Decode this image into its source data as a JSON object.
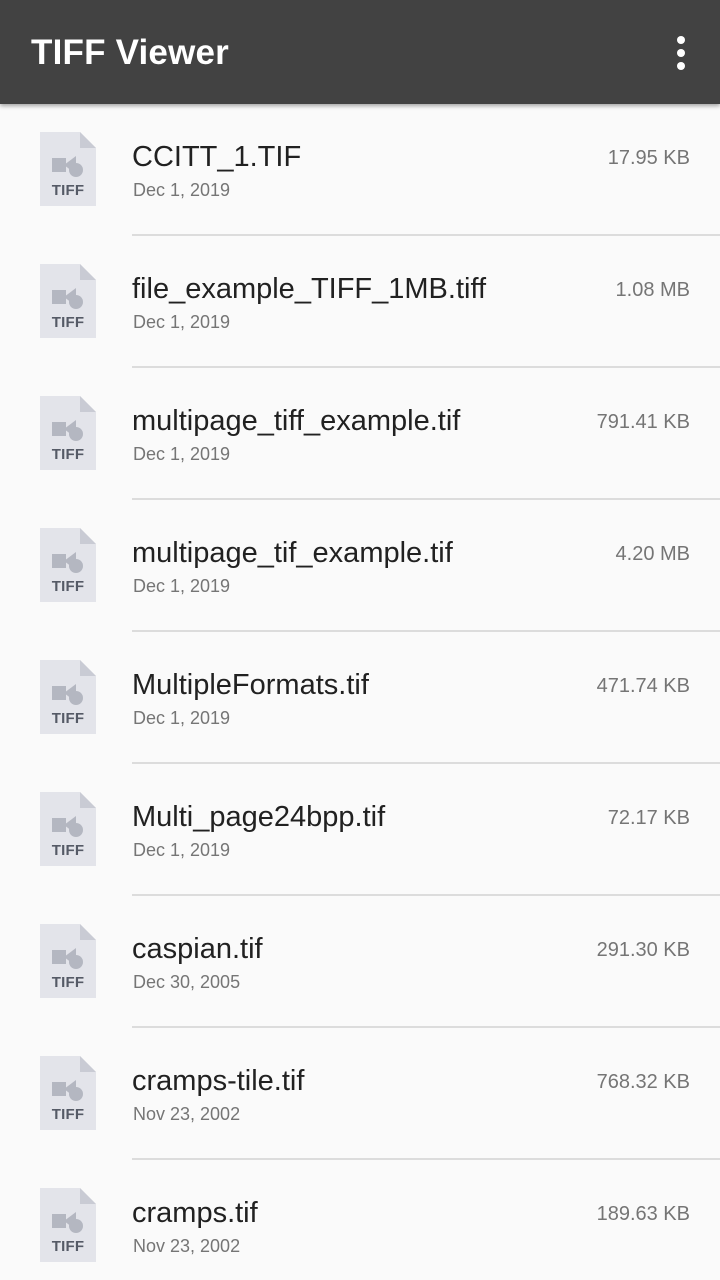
{
  "app": {
    "title": "TIFF Viewer",
    "menu_icon": "more-vert-icon",
    "toolbar_color": "#424242"
  },
  "file_icon": {
    "name": "tiff-file-icon",
    "label": "TIFF"
  },
  "files": [
    {
      "name": "CCITT_1.TIF",
      "date": "Dec 1, 2019",
      "size": "17.95 KB"
    },
    {
      "name": "file_example_TIFF_1MB.tiff",
      "date": "Dec 1, 2019",
      "size": "1.08 MB"
    },
    {
      "name": "multipage_tiff_example.tif",
      "date": "Dec 1, 2019",
      "size": "791.41 KB"
    },
    {
      "name": "multipage_tif_example.tif",
      "date": "Dec 1, 2019",
      "size": "4.20 MB"
    },
    {
      "name": "MultipleFormats.tif",
      "date": "Dec 1, 2019",
      "size": "471.74 KB"
    },
    {
      "name": "Multi_page24bpp.tif",
      "date": "Dec 1, 2019",
      "size": "72.17 KB"
    },
    {
      "name": "caspian.tif",
      "date": "Dec 30, 2005",
      "size": "291.30 KB"
    },
    {
      "name": "cramps-tile.tif",
      "date": "Nov 23, 2002",
      "size": "768.32 KB"
    },
    {
      "name": "cramps.tif",
      "date": "Nov 23, 2002",
      "size": "189.63 KB"
    }
  ]
}
